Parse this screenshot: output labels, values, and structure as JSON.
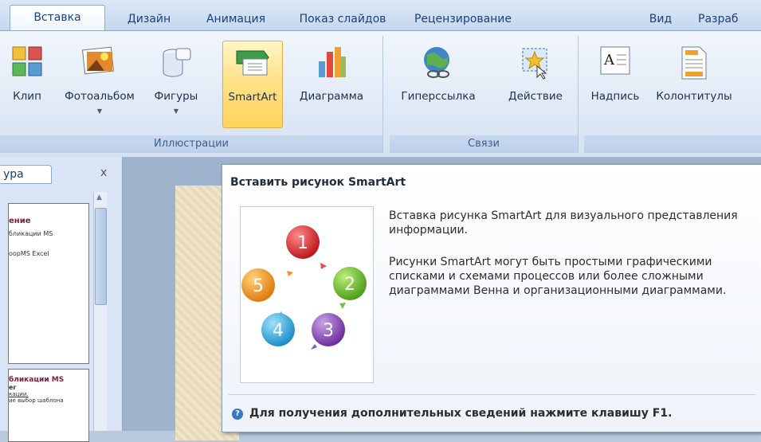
{
  "tabs": [
    {
      "label": "Вставка",
      "active": true
    },
    {
      "label": "Дизайн"
    },
    {
      "label": "Анимация"
    },
    {
      "label": "Показ слайдов"
    },
    {
      "label": "Рецензирование"
    },
    {
      "label": "Вид"
    },
    {
      "label": "Разраб"
    }
  ],
  "ribbon": {
    "illustrations": {
      "label": "Иллюстрации",
      "buttons": [
        {
          "label": "Клип",
          "icon": "clip-art-icon"
        },
        {
          "label": "Фотоальбом",
          "icon": "photo-album-icon",
          "dropdown": true
        },
        {
          "label": "Фигуры",
          "icon": "shapes-icon",
          "dropdown": true
        },
        {
          "label": "SmartArt",
          "icon": "smartart-icon",
          "highlighted": true
        },
        {
          "label": "Диаграмма",
          "icon": "chart-icon"
        }
      ]
    },
    "links": {
      "label": "Связи",
      "buttons": [
        {
          "label": "Гиперссылка",
          "icon": "hyperlink-icon"
        },
        {
          "label": "Действие",
          "icon": "action-icon"
        }
      ]
    },
    "text": {
      "buttons": [
        {
          "label": "Надпись",
          "icon": "text-box-icon"
        },
        {
          "label": "Колонтитулы",
          "icon": "header-footer-icon"
        }
      ]
    }
  },
  "slides_pane": {
    "tab_label": "ура",
    "close": "x",
    "thumb1": {
      "title": "ение",
      "line1": "бликации MS",
      "line2": "оорMS Excel"
    },
    "thumb2": {
      "title": "бликации MS",
      "line1": "ег",
      "line2": "кации.",
      "line3": "ие выбор шаблона"
    }
  },
  "tooltip": {
    "title": "Вставить рисунок SmartArt",
    "p1": "Вставка рисунка SmartArt для визуального представления информации.",
    "p2": "Рисунки SmartArt могут быть простыми графическими списками и схемами процессов или более сложными диаграммами Венна и организационными диаграммами.",
    "help": "Для получения дополнительных сведений нажмите клавишу F1.",
    "cycle_numbers": [
      "1",
      "2",
      "3",
      "4",
      "5"
    ]
  }
}
